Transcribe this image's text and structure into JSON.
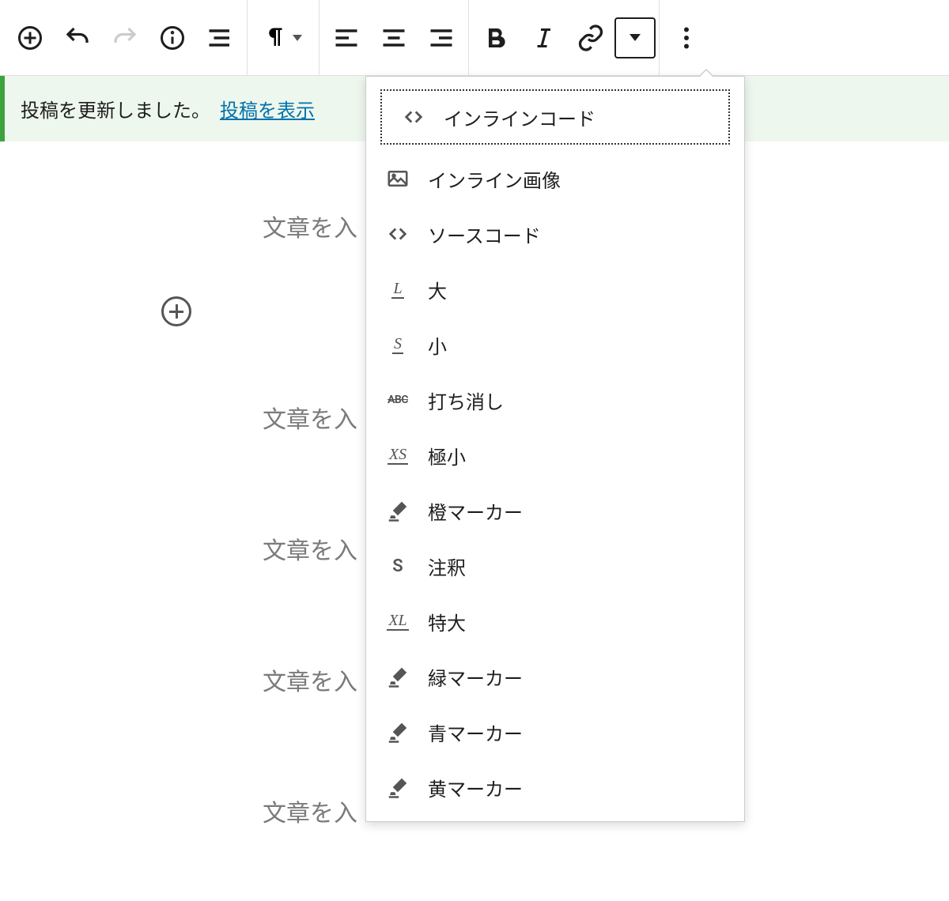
{
  "notice": {
    "message": "投稿を更新しました。",
    "link_text": "投稿を表示"
  },
  "editor": {
    "placeholder": "文章を入"
  },
  "dropdown": {
    "items": [
      {
        "icon": "code",
        "label": "インラインコード",
        "focused": true
      },
      {
        "icon": "image",
        "label": "インライン画像"
      },
      {
        "icon": "code",
        "label": "ソースコード"
      },
      {
        "icon": "size-l",
        "label": "大"
      },
      {
        "icon": "size-s",
        "label": "小"
      },
      {
        "icon": "strikethrough",
        "label": "打ち消し"
      },
      {
        "icon": "size-xs",
        "label": "極小"
      },
      {
        "icon": "marker",
        "label": "橙マーカー"
      },
      {
        "icon": "annotation",
        "label": "注釈"
      },
      {
        "icon": "size-xl",
        "label": "特大"
      },
      {
        "icon": "marker",
        "label": "緑マーカー"
      },
      {
        "icon": "marker",
        "label": "青マーカー"
      },
      {
        "icon": "marker",
        "label": "黄マーカー"
      }
    ]
  }
}
